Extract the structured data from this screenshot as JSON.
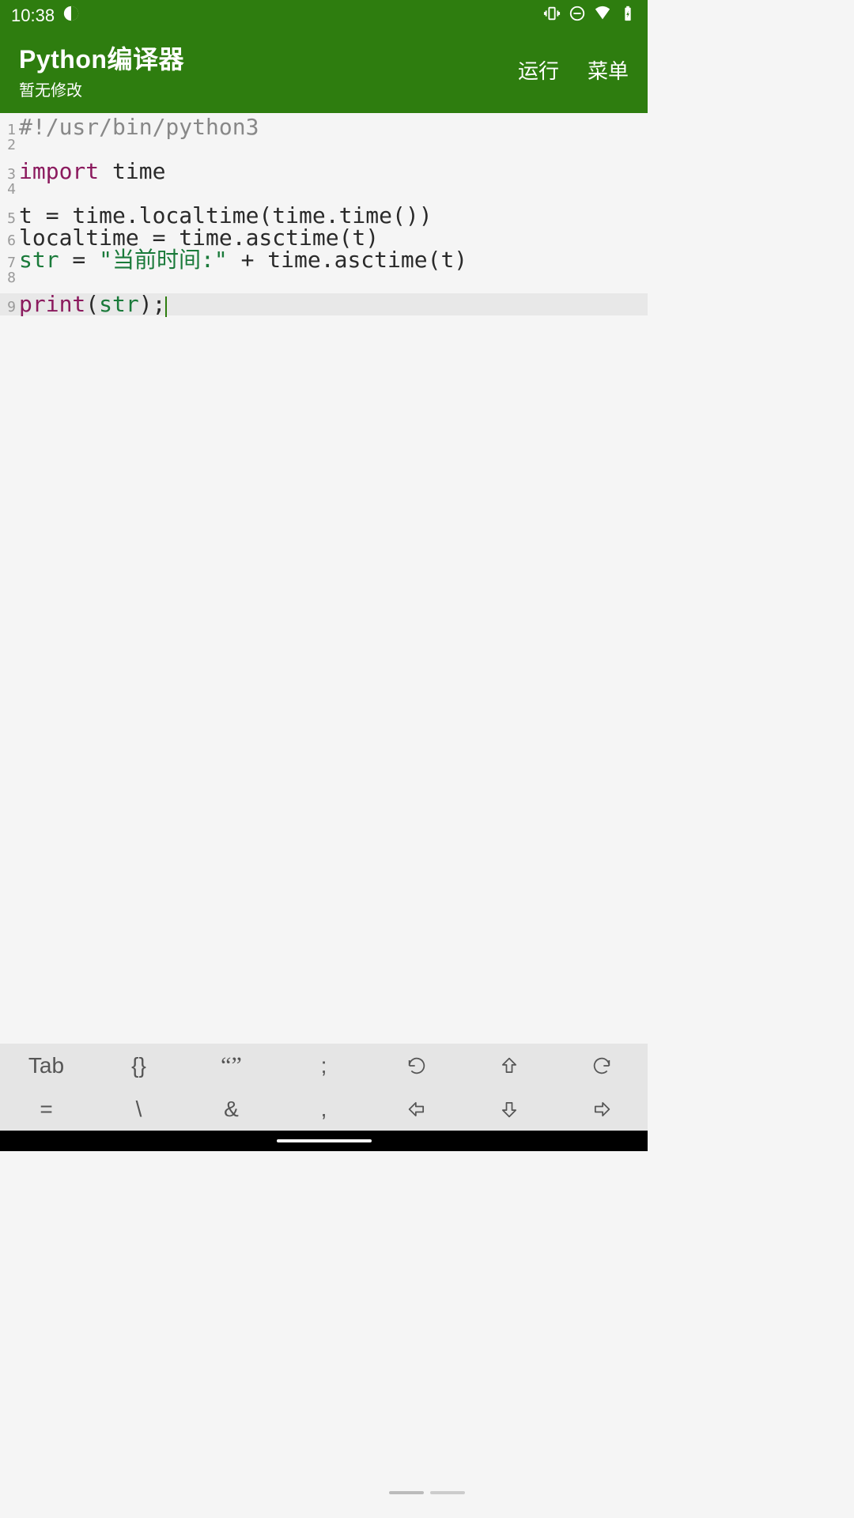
{
  "status": {
    "time": "10:38"
  },
  "header": {
    "title": "Python编译器",
    "subtitle": "暂无修改",
    "run": "运行",
    "menu": "菜单"
  },
  "code": {
    "lines": [
      {
        "n": 1,
        "tokens": [
          {
            "c": "comment",
            "t": "#!/usr/bin/python3"
          }
        ]
      },
      {
        "n": 2,
        "tokens": []
      },
      {
        "n": 3,
        "tokens": [
          {
            "c": "keyword",
            "t": "import"
          },
          {
            "c": "plain",
            "t": " time"
          }
        ]
      },
      {
        "n": 4,
        "tokens": []
      },
      {
        "n": 5,
        "tokens": [
          {
            "c": "plain",
            "t": "t = time.localtime(time.time())"
          }
        ]
      },
      {
        "n": 6,
        "tokens": [
          {
            "c": "plain",
            "t": "localtime = time.asctime(t)"
          }
        ]
      },
      {
        "n": 7,
        "tokens": [
          {
            "c": "builtin",
            "t": "str"
          },
          {
            "c": "plain",
            "t": " = "
          },
          {
            "c": "string",
            "t": "\"当前时间:\""
          },
          {
            "c": "plain",
            "t": " + time.asctime(t)"
          }
        ]
      },
      {
        "n": 8,
        "tokens": []
      },
      {
        "n": 9,
        "current": true,
        "cursor": true,
        "tokens": [
          {
            "c": "keyword",
            "t": "print"
          },
          {
            "c": "plain",
            "t": "("
          },
          {
            "c": "builtin",
            "t": "str"
          },
          {
            "c": "plain",
            "t": ");"
          }
        ]
      }
    ]
  },
  "toolbar": {
    "row1": [
      "Tab",
      "{}",
      "“”",
      ";",
      "↺",
      "⇧",
      "↻"
    ],
    "row2": [
      "=",
      "\\",
      "&",
      ",",
      "⇦",
      "⇩",
      "⇨"
    ]
  }
}
